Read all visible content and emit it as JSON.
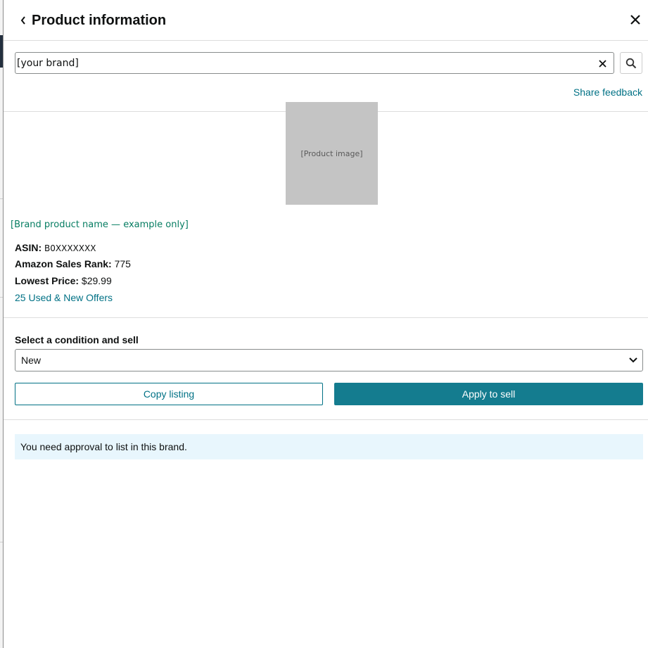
{
  "header": {
    "title": "Product information",
    "back_icon": "chevron-left-icon",
    "close_icon": "close-icon"
  },
  "search": {
    "value": "[your brand]",
    "clear_icon": "close-icon",
    "search_icon": "search-icon"
  },
  "feedback": {
    "label": "Share feedback"
  },
  "product": {
    "image_label": "[Product image]",
    "name": "[Brand product name — example only]",
    "asin_label": "ASIN:",
    "asin_value": "B0XXXXXXX",
    "rank_label": "Amazon Sales Rank:",
    "rank_value": "775",
    "price_label": "Lowest Price:",
    "price_value": "$29.99",
    "offers_link": "25 Used & New Offers"
  },
  "condition": {
    "label": "Select a condition and sell",
    "selected": "New",
    "chevron_icon": "chevron-down-icon"
  },
  "actions": {
    "copy_label": "Copy listing",
    "apply_label": "Apply to sell"
  },
  "alert": {
    "message": "You need approval to list in this brand."
  },
  "colors": {
    "link": "#007185",
    "product_link": "#067d62",
    "primary_button": "#147c8f",
    "alert_bg": "#e8f6fd"
  }
}
